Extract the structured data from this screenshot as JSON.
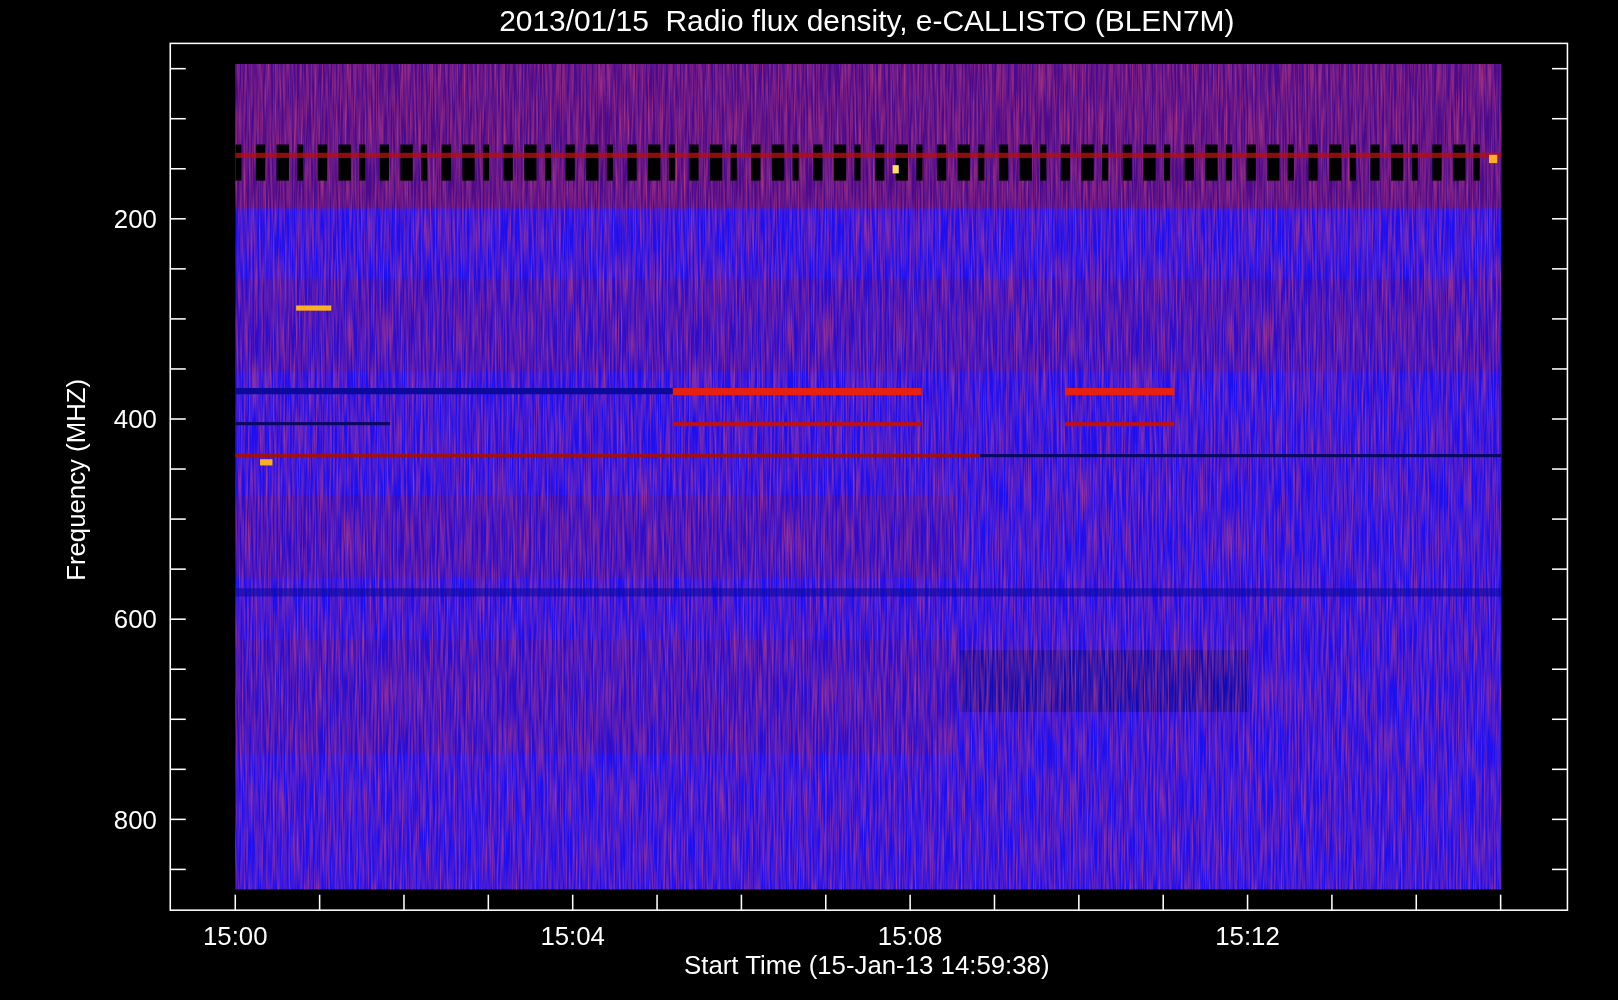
{
  "title": "2013/01/15  Radio flux density, e-CALLISTO (BLEN7M)",
  "y_axis": {
    "label": "Frequency (MHZ)",
    "ticks": [
      "200",
      "400",
      "600",
      "800"
    ]
  },
  "x_axis": {
    "label": "Start Time (15-Jan-13 14:59:38)",
    "ticks": [
      "15:00",
      "15:04",
      "15:08",
      "15:12"
    ]
  }
}
